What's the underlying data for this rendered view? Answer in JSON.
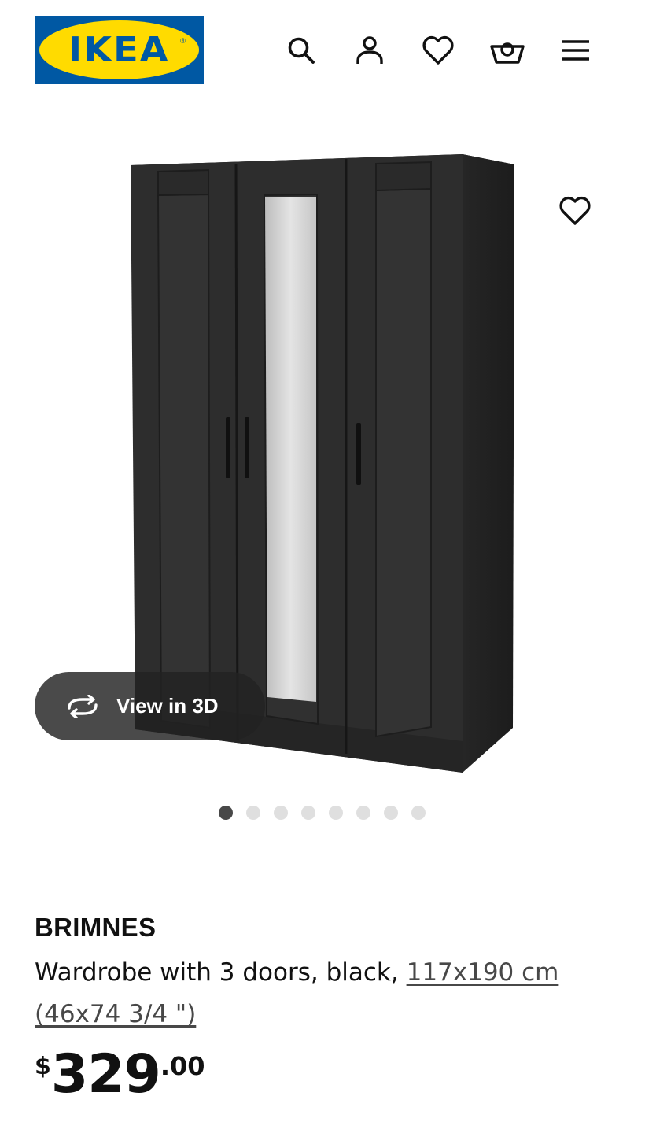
{
  "header": {
    "logo_text": "IKEA",
    "logo_mark": "®",
    "icons": [
      "search-icon",
      "account-icon",
      "heart-icon",
      "cart-icon",
      "menu-icon"
    ]
  },
  "gallery": {
    "view_3d_label": "View in 3D",
    "image_count": 8,
    "active_index": 0
  },
  "product": {
    "name": "BRIMNES",
    "description_prefix": "Wardrobe with 3 doors, black, ",
    "size_link": "117x190 cm (46x74 3/4 \")",
    "price": {
      "currency": "$",
      "integer": "329",
      "decimal": ".00"
    }
  },
  "colors": {
    "ikea_blue": "#0058a3",
    "ikea_yellow": "#ffdb00",
    "text": "#111111",
    "muted_link": "#484848"
  }
}
